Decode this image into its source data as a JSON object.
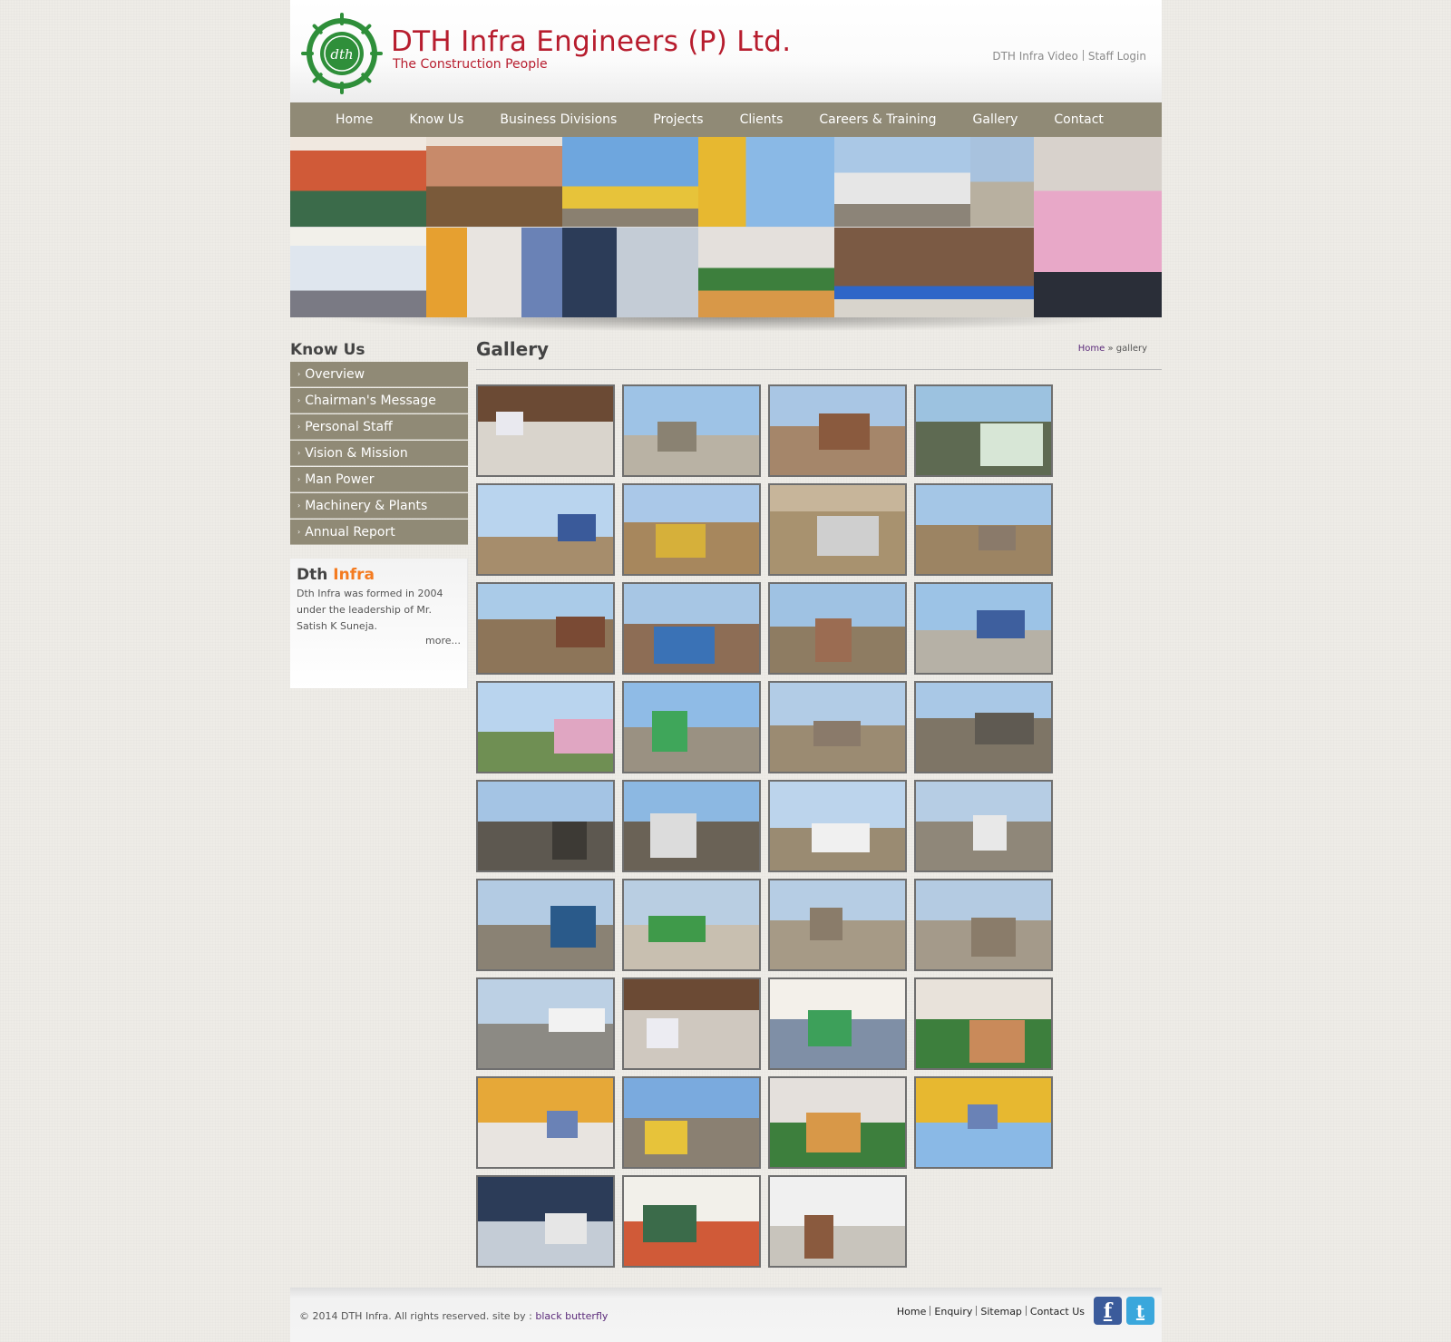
{
  "header": {
    "company_name": "DTH Infra Engineers (P) Ltd.",
    "tagline": "The Construction People",
    "logo_text": "dth",
    "top_links": [
      "DTH Infra Video",
      "Staff Login"
    ]
  },
  "nav": [
    "Home",
    "Know Us",
    "Business Divisions",
    "Projects",
    "Clients",
    "Careers & Training",
    "Gallery",
    "Contact"
  ],
  "sidebar": {
    "title": "Know Us",
    "items": [
      "Overview",
      "Chairman's Message",
      "Personal Staff",
      "Vision & Mission",
      "Man Power",
      "Machinery & Plants",
      "Annual Report"
    ],
    "about_title_a": "Dth",
    "about_title_b": "Infra",
    "about_text": "Dth Infra was formed in 2004 under the leadership of Mr. Satish K Suneja.",
    "about_more": "more..."
  },
  "main": {
    "title": "Gallery",
    "breadcrumb_home": "Home",
    "breadcrumb_sep": "»",
    "breadcrumb_current": "gallery",
    "photo_count": 35
  },
  "footer": {
    "copyright": "© 2014 DTH Infra. All rights reserved. site by :",
    "credit": "black butterfly",
    "links": [
      "Home",
      "Enquiry",
      "Sitemap",
      "Contact Us"
    ],
    "facebook": "f",
    "twitter": "t"
  },
  "colors": {
    "brand_red": "#b71d2e",
    "brand_green": "#2f8f3a",
    "nav_bg": "#908a76",
    "accent_orange": "#f47b20",
    "link_purple": "#5b2a7a"
  }
}
